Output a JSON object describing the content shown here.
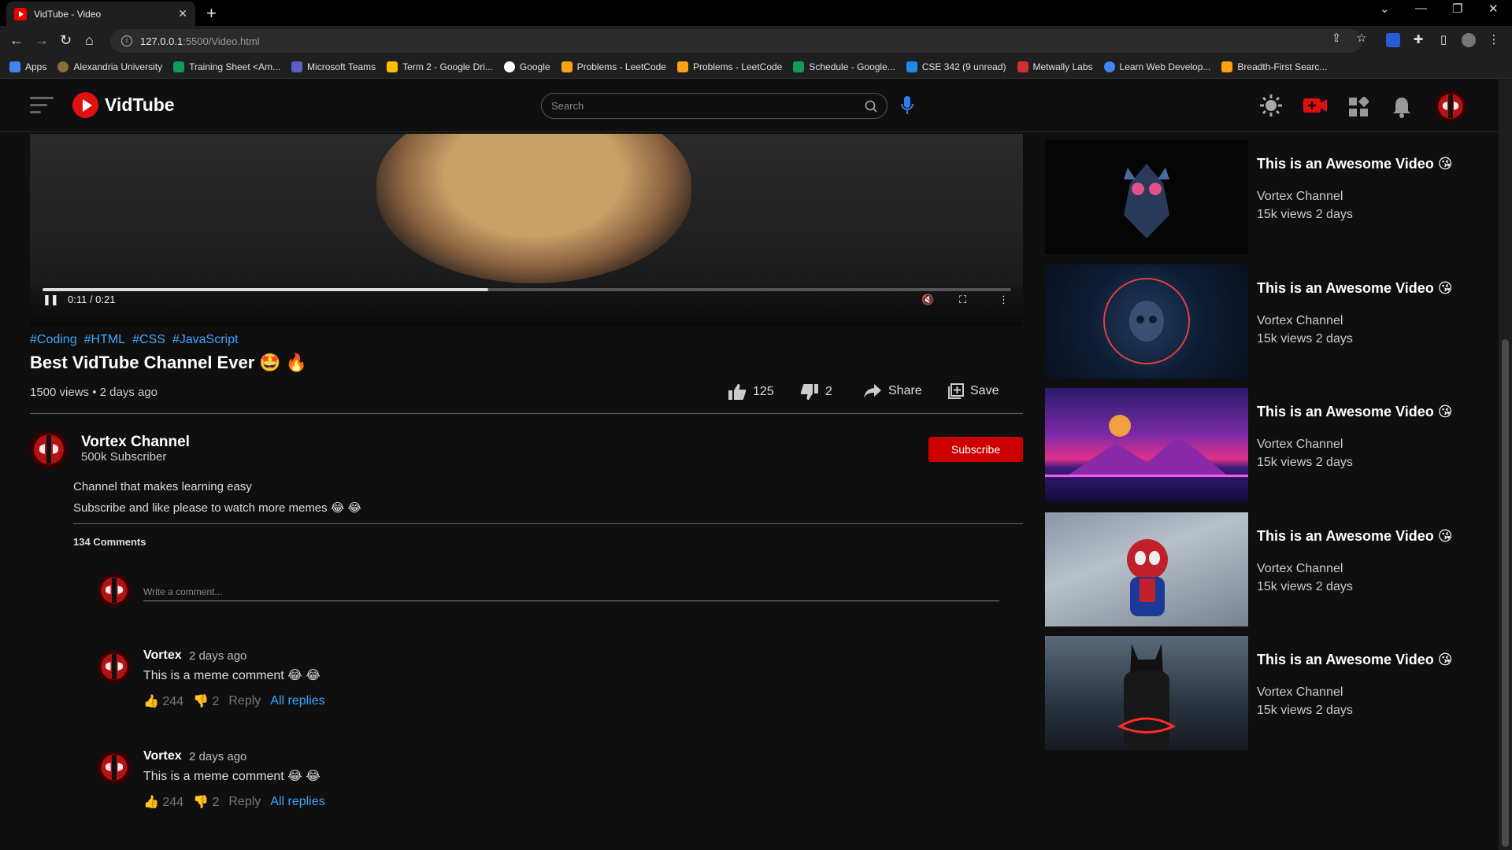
{
  "browser": {
    "tab_title": "VidTube - Video",
    "url_host": "127.0.0.1",
    "url_rest": ":5500/Video.html",
    "bookmarks": [
      {
        "label": "Apps",
        "color": "#4285f4"
      },
      {
        "label": "Alexandria University",
        "color": "#8a6d3b"
      },
      {
        "label": "Training Sheet <Am...",
        "color": "#0f9d58"
      },
      {
        "label": "Microsoft Teams",
        "color": "#5b5fc7"
      },
      {
        "label": "Term 2 - Google Dri...",
        "color": "#fbbc04"
      },
      {
        "label": "Google",
        "color": "#ffffff"
      },
      {
        "label": "Problems - LeetCode",
        "color": "#ffa116"
      },
      {
        "label": "Problems - LeetCode",
        "color": "#ffa116"
      },
      {
        "label": "Schedule - Google...",
        "color": "#0f9d58"
      },
      {
        "label": "CSE 342 (9 unread)",
        "color": "#1e88e5"
      },
      {
        "label": "Metwally Labs",
        "color": "#d32f2f"
      },
      {
        "label": "Learn Web Develop...",
        "color": "#4285f4"
      },
      {
        "label": "Breadth-First Searc...",
        "color": "#ffa116"
      }
    ]
  },
  "header": {
    "logo_text": "VidTube",
    "search_placeholder": "Search"
  },
  "player": {
    "time": "0:11 / 0:21",
    "progress": 0.46
  },
  "video": {
    "tags": [
      "#Coding",
      "#HTML",
      "#CSS",
      "#JavaScript"
    ],
    "title": "Best VidTube Channel Ever 🤩 🔥",
    "meta": "1500 views • 2 days ago",
    "likes": "125",
    "dislikes": "2",
    "share_label": "Share",
    "save_label": "Save"
  },
  "channel": {
    "name": "Vortex Channel",
    "subscribers": "500k Subscriber",
    "subscribe_label": "Subscribe",
    "description_1": "Channel that makes learning easy",
    "description_2": "Subscribe and like please to watch more memes 😂 😂"
  },
  "comments": {
    "count_label": "134 Comments",
    "input_placeholder": "Write a comment...",
    "items": [
      {
        "author": "Vortex",
        "time": "2 days ago",
        "text": "This is a meme comment 😂 😂",
        "likes": "244",
        "dislikes": "2",
        "reply": "Reply",
        "all_replies": "All replies"
      },
      {
        "author": "Vortex",
        "time": "2 days ago",
        "text": "This is a meme comment 😂 😂",
        "likes": "244",
        "dislikes": "2",
        "reply": "Reply",
        "all_replies": "All replies"
      }
    ]
  },
  "recommendations": [
    {
      "title": "This is an Awesome Video 😘",
      "channel": "Vortex Channel",
      "views": "15k views 2 days"
    },
    {
      "title": "This is an Awesome Video 😘",
      "channel": "Vortex Channel",
      "views": "15k views 2 days"
    },
    {
      "title": "This is an Awesome Video 😘",
      "channel": "Vortex Channel",
      "views": "15k views 2 days"
    },
    {
      "title": "This is an Awesome Video 😘",
      "channel": "Vortex Channel",
      "views": "15k views 2 days"
    },
    {
      "title": "This is an Awesome Video 😘",
      "channel": "Vortex Channel",
      "views": "15k views 2 days"
    }
  ],
  "colors": {
    "accent": "#cc0000",
    "link": "#3ea6ff",
    "background": "#0f0f0f"
  }
}
